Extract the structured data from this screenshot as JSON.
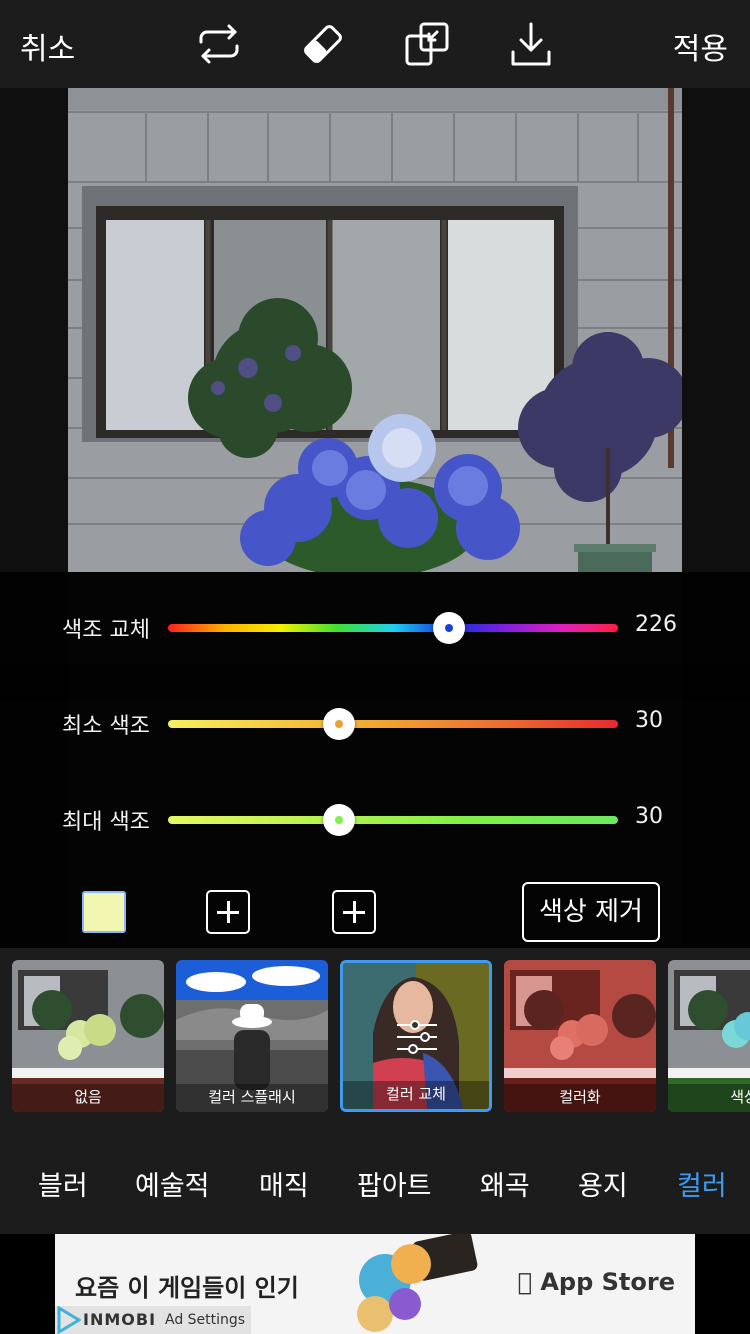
{
  "toolbar": {
    "cancel_label": "취소",
    "apply_label": "적용",
    "icons": [
      "swap-icon",
      "eraser-icon",
      "compare-icon",
      "download-icon"
    ]
  },
  "sliders": [
    {
      "label": "색조 교체",
      "value": "226",
      "fraction": 0.625,
      "dot_color": "#1b3fd8"
    },
    {
      "label": "최소 색조",
      "value": "30",
      "fraction": 0.38,
      "dot_color": "#f0a030"
    },
    {
      "label": "최대 색조",
      "value": "30",
      "fraction": 0.38,
      "dot_color": "#7ff046"
    }
  ],
  "swatch_color": "#f1f7b0",
  "remove_color_label": "색상 제거",
  "filters": [
    {
      "label": "없음"
    },
    {
      "label": "컬러 스플래시"
    },
    {
      "label": "컬러 교체",
      "selected": true
    },
    {
      "label": "컬러화"
    },
    {
      "label": "색상"
    }
  ],
  "categories": [
    "블러",
    "예술적",
    "매직",
    "팝아트",
    "왜곡",
    "용지",
    "컬러"
  ],
  "active_category": "컬러",
  "ad": {
    "headline": "요즘 이 게임들이 인기",
    "store": "App Store",
    "brand": "INMOBI",
    "settings": "Ad Settings"
  },
  "colors": {
    "accent": "#3f9bf2",
    "bar_bg": "#1c1c1c"
  }
}
